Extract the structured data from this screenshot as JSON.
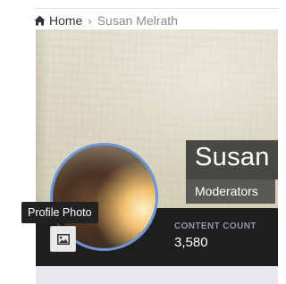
{
  "breadcrumb": {
    "home_label": "Home",
    "home_icon": "home-icon",
    "separator_icon": "chevron-right-icon",
    "current": "Susan Melrath"
  },
  "profile": {
    "name": "Susan",
    "group": "Moderators",
    "avatar_ring_color": "#6f94d8"
  },
  "stats": [
    {
      "label": "CONTENT COUNT",
      "value": "3,580"
    }
  ],
  "photo_button": {
    "icon": "image-icon",
    "tooltip": "Profile Photo"
  }
}
